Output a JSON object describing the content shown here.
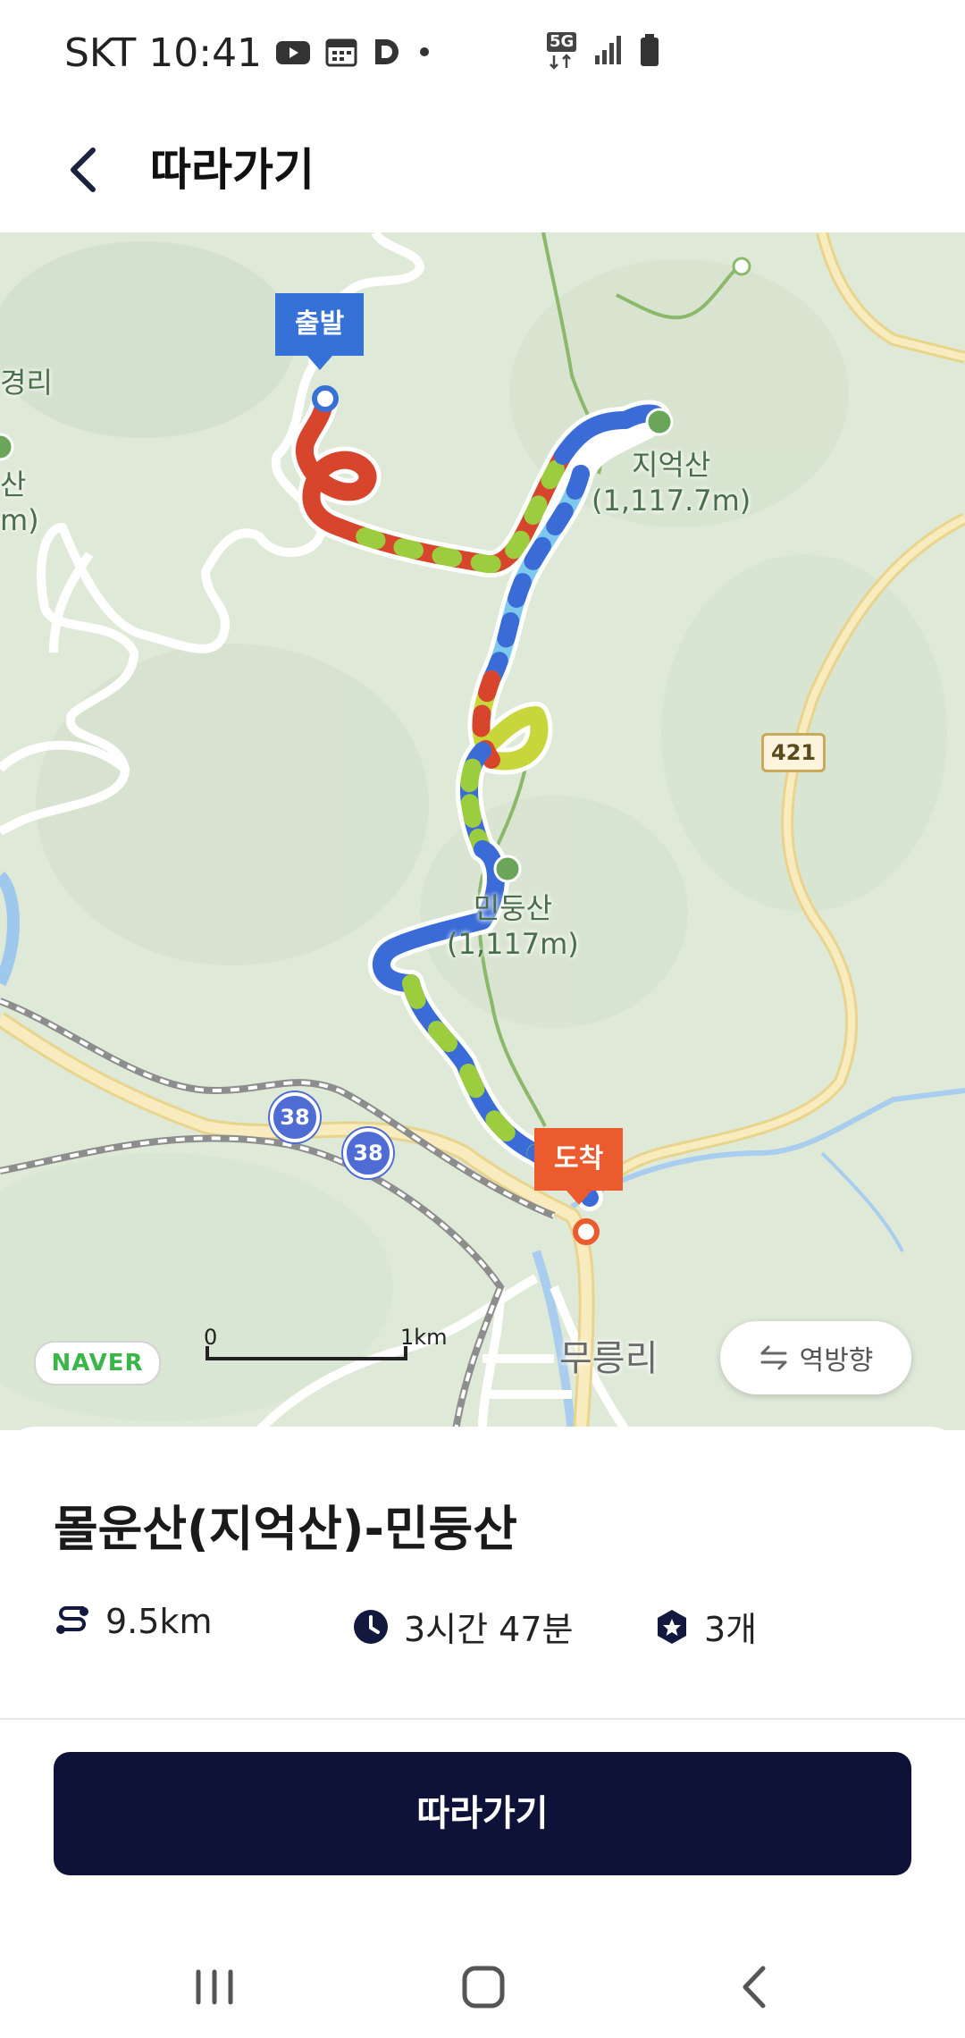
{
  "status_bar": {
    "carrier": "SKT",
    "time": "10:41",
    "network": "5G",
    "icons": [
      "youtube-icon",
      "calendar-icon",
      "d-app-icon",
      "notification-dot-icon",
      "5g-icon",
      "signal-icon",
      "battery-icon"
    ]
  },
  "header": {
    "title": "따라가기",
    "back_icon": "chevron-left-icon"
  },
  "map": {
    "start_label": "출발",
    "end_label": "도착",
    "places": {
      "jieoksan_name": "지억산",
      "jieoksan_height": "(1,117.7m)",
      "mindungsan_name": "민둥산",
      "mindungsan_height": "(1,117m)",
      "left_village": "경리",
      "left_peak": "산",
      "left_peak_height": "m)",
      "bottom_village": "무릉리"
    },
    "road_badges": [
      "38",
      "38",
      "421"
    ],
    "logo": "NAVER",
    "scale_start": "0",
    "scale_end": "1km",
    "reverse_label": "역방향",
    "reverse_icon": "swap-arrows-icon",
    "colors": {
      "start": "#3671d8",
      "end": "#ec5b2e",
      "land": "#dfe9d8",
      "road_major": "#f6e6a6"
    }
  },
  "course": {
    "title": "몰운산(지억산)-민둥산",
    "distance": "9.5km",
    "duration": "3시간 47분",
    "count": "3개",
    "distance_icon": "route-icon",
    "duration_icon": "clock-icon",
    "count_icon": "badge-star-icon"
  },
  "follow_button": {
    "label": "따라가기",
    "color": "#0e1238"
  },
  "nav_bar": {
    "icons": [
      "recent-apps-icon",
      "home-icon",
      "back-icon"
    ]
  }
}
